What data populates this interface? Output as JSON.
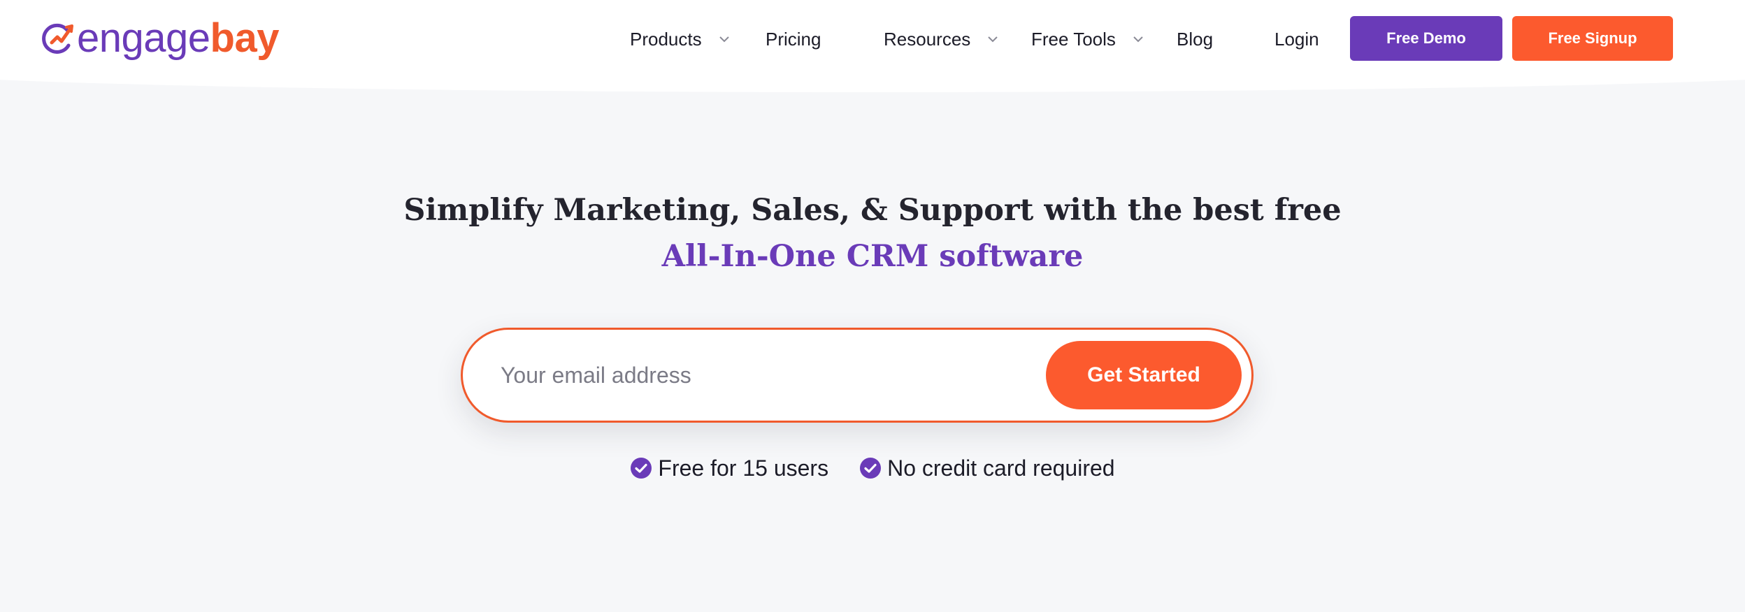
{
  "brand": {
    "name_part1": "engage",
    "name_part2": "bay",
    "primary_color": "#6a3bb8",
    "accent_color": "#f05a2c"
  },
  "nav": {
    "items": [
      {
        "label": "Products",
        "has_dropdown": true
      },
      {
        "label": "Pricing",
        "has_dropdown": false
      },
      {
        "label": "Resources",
        "has_dropdown": true
      },
      {
        "label": "Free Tools",
        "has_dropdown": true
      },
      {
        "label": "Blog",
        "has_dropdown": false
      },
      {
        "label": "Login",
        "has_dropdown": false
      }
    ],
    "demo_button": "Free Demo",
    "signup_button": "Free Signup"
  },
  "hero": {
    "headline_line1": "Simplify Marketing, Sales, & Support with the best free",
    "headline_line2": "All-In-One CRM software",
    "email_placeholder": "Your email address",
    "cta_button": "Get Started",
    "benefits": [
      "Free for 15 users",
      "No credit card required"
    ]
  },
  "icons": {
    "chevron": "chevron-down-icon",
    "check": "check-circle-icon",
    "logo": "engagebay-logo-mark"
  }
}
